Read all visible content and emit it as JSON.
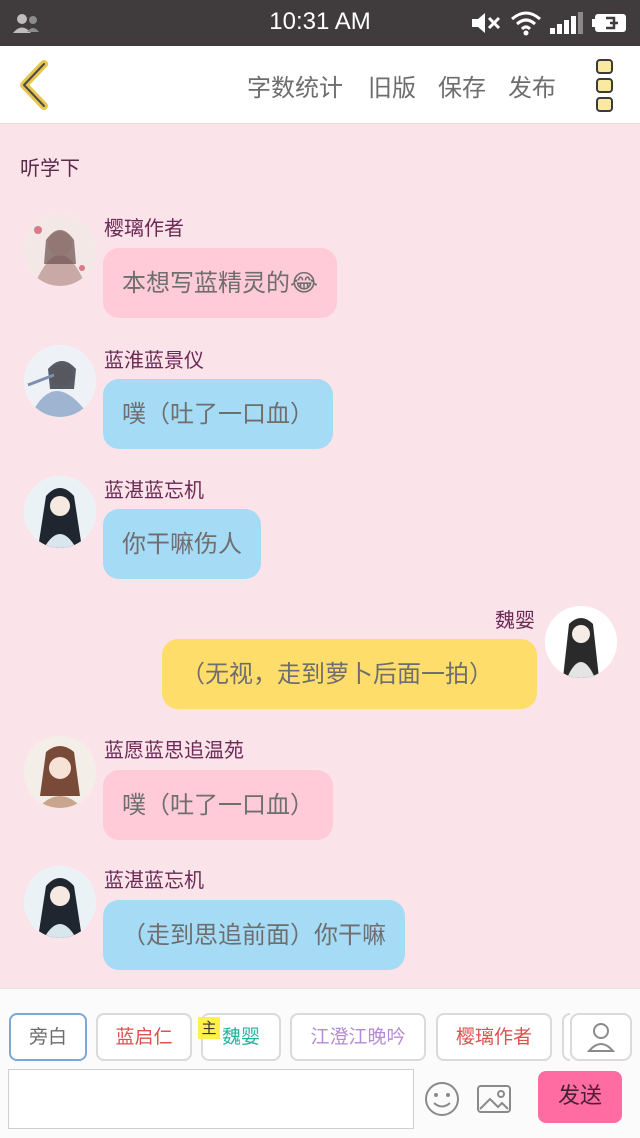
{
  "status_bar": {
    "time": "10:31 AM",
    "icons": [
      "contacts-icon",
      "mute-icon",
      "wifi-icon",
      "signal-icon",
      "battery-icon"
    ]
  },
  "toolbar": {
    "actions": [
      "字数统计",
      "旧版",
      "保存",
      "发布"
    ],
    "icons": [
      "back-chevron-icon",
      "more-menu-icon"
    ],
    "accent": "#e7c64d"
  },
  "chat": {
    "narration": "听学下",
    "messages": [
      {
        "name": "樱璃作者",
        "text": "本想写蓝精灵的😂",
        "side": "left",
        "color": "#ffcbd8"
      },
      {
        "name": "蓝淮蓝景仪",
        "text": "噗（吐了一口血）",
        "side": "left",
        "color": "#a6dbf6"
      },
      {
        "name": "蓝湛蓝忘机",
        "text": "你干嘛伤人",
        "side": "left",
        "color": "#a6dbf6"
      },
      {
        "name": "魏婴",
        "text": "（无视，走到萝卜后面一拍）",
        "side": "right",
        "color": "#ffdd6a"
      },
      {
        "name": "蓝愿蓝思追温苑",
        "text": "噗（吐了一口血）",
        "side": "left",
        "color": "#ffcbd8"
      },
      {
        "name": "蓝湛蓝忘机",
        "text": "（走到思追前面）你干嘛",
        "side": "left",
        "color": "#a6dbf6"
      }
    ]
  },
  "characters": [
    {
      "label": "旁白",
      "color": "#6d6d6d",
      "selected": true
    },
    {
      "label": "蓝启仁",
      "color": "#d9534f"
    },
    {
      "label": "魏婴",
      "color": "#26b3a0",
      "badge": "主"
    },
    {
      "label": "江澄江晚吟",
      "color": "#b58ad6"
    },
    {
      "label": "樱璃作者",
      "color": "#d9534f"
    }
  ],
  "input": {
    "placeholder": "",
    "send_label": "发送",
    "send_color": "#ff6ca1",
    "icons": [
      "add-character-icon",
      "emoji-icon",
      "image-icon"
    ]
  }
}
